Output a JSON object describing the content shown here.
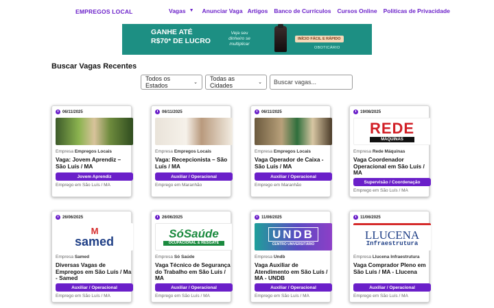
{
  "header": {
    "brand": "EMPREGOS LOCAL",
    "nav": [
      "Vagas",
      "Anunciar Vaga",
      "Artigos",
      "Banco de Currículos",
      "Cursos Online",
      "Politicas de Privacidade"
    ]
  },
  "ad": {
    "headline": "GANHE ATÉ R$70* DE LUCRO",
    "tagline": "Veja seu dinheiro se multiplicar",
    "cta": "INÍCIO FÁCIL E RÁPIDO",
    "brand": "OBOTICÁRIO"
  },
  "section": {
    "title": "Buscar Vagas Recentes"
  },
  "filters": {
    "state": "Todos os Estados",
    "city": "Todas as Cidades",
    "search_placeholder": "Buscar vagas..."
  },
  "company_prefix": "Empresa",
  "jobs": [
    {
      "date": "06/11/2025",
      "company": "Empregos Locais",
      "title": "Vaga: Jovem Aprendiz – São Luís / MA",
      "tag": "Jovem Aprendiz",
      "location": "Emprego em São Luís / MA",
      "thumb": "students-photo"
    },
    {
      "date": "06/11/2025",
      "company": "Empregos Locais",
      "title": "Vaga: Recepcionista – São Luís / MA",
      "tag": "Auxiliar / Operacional",
      "location": "Emprego em Maranhão",
      "thumb": "receptionist-photo"
    },
    {
      "date": "06/11/2025",
      "company": "Empregos Locais",
      "title": "Vaga Operador de Caixa - São Luís / MA",
      "tag": "Auxiliar / Operacional",
      "location": "Emprego em Maranhão",
      "thumb": "cashier-photo"
    },
    {
      "date": "19/08/2025",
      "company": "Rede Máquinas",
      "title": "Vaga Coordenador Operacional em São Luís / MA",
      "tag": "Supervisão / Coordenação",
      "location": "Emprego em São Luís / MA",
      "thumb": "rede-maquinas-logo",
      "logo_text": "REDE",
      "logo_sub": "MÁQUINAS"
    },
    {
      "date": "26/06/2025",
      "company": "Samed",
      "title": "Diversas Vagas de Empregos em São Luís / Ma - Samed",
      "tag": "Auxiliar / Operacional",
      "location": "Emprego em São Luís / MA",
      "thumb": "samed-logo",
      "logo_text": "samed"
    },
    {
      "date": "26/06/2025",
      "company": "Só Saúde",
      "title": "Vaga Técnico de Segurança do Trabalho em São Luís / MA",
      "tag": "Auxiliar / Operacional",
      "location": "Emprego em São Luís / MA",
      "thumb": "so-saude-logo",
      "logo_text": "SóSaúde",
      "logo_sub": "OCUPACIONAL & RESGATE"
    },
    {
      "date": "11/06/2025",
      "company": "Undb",
      "title": "Vaga Auxiliar de Atendimento em São Luís / MA - UNDB",
      "tag": "Auxiliar / Operacional",
      "location": "Emprego em São Luís / MA",
      "thumb": "undb-logo",
      "logo_text": "UNDB",
      "logo_sub": "CENTRO UNIVERSITÁRIO"
    },
    {
      "date": "11/06/2025",
      "company": "Llucena Infraestrutura",
      "title": "Vaga Comprador Pleno em São Luís / MA - Llucena",
      "tag": "Auxiliar / Operacional",
      "location": "Emprego em São Luís / MA",
      "thumb": "llucena-logo",
      "logo_text": "LLUCENA",
      "logo_sub": "Infraestrutura"
    }
  ]
}
